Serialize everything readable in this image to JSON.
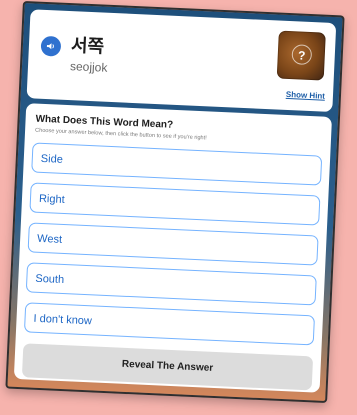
{
  "header": {
    "word": "서쪽",
    "romanization": "seojjok",
    "hint_symbol": "?",
    "show_hint_label": "Show Hint"
  },
  "question": {
    "title": "What Does This Word Mean?",
    "subtitle": "Choose your answer below, then click the button to see if you're right!",
    "options": [
      {
        "label": "Side"
      },
      {
        "label": "Right"
      },
      {
        "label": "West"
      },
      {
        "label": "South"
      },
      {
        "label": "I don't know"
      }
    ],
    "reveal_label": "Reveal The Answer"
  },
  "icons": {
    "speaker": "speaker-icon",
    "hint": "question-mark-icon"
  },
  "colors": {
    "accent_blue": "#2f71cf",
    "option_border": "#75b3ff",
    "option_text": "#1d66c5"
  }
}
